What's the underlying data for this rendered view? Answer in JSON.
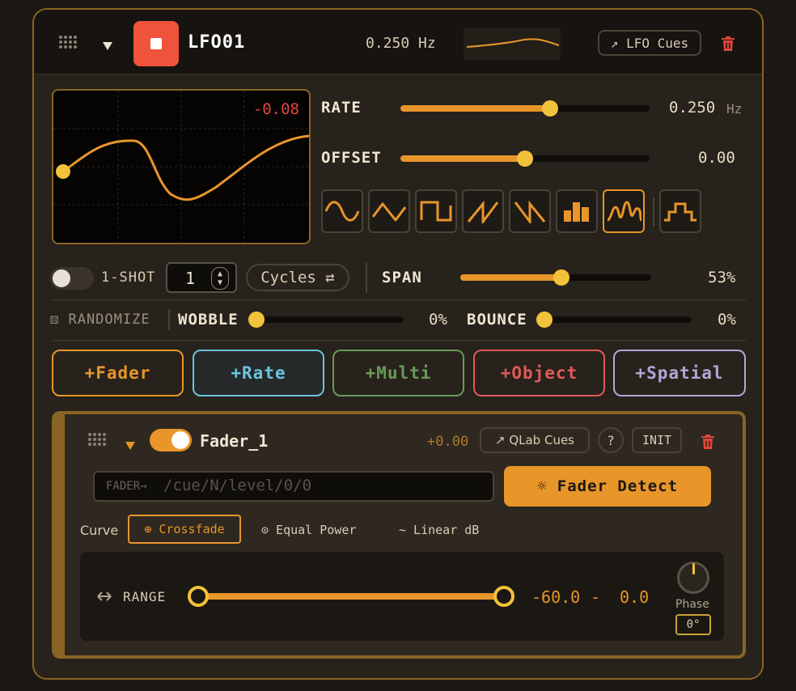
{
  "header": {
    "title": "LFO01",
    "freq_display": "0.250 Hz",
    "cues_button": "↗ LFO Cues"
  },
  "scope": {
    "readout": "-0.08"
  },
  "rate": {
    "label": "RATE",
    "value": "0.250",
    "unit": "Hz",
    "level": 0.6
  },
  "offset": {
    "label": "OFFSET",
    "value": "0.00",
    "level": 0.5
  },
  "waveforms": [
    "sine-icon",
    "triangle-icon",
    "square-icon",
    "saw-up-icon",
    "saw-down-icon",
    "random-bars-icon",
    "smooth-random-icon",
    "step-icon"
  ],
  "waveform_selected": 6,
  "oneshot": {
    "label": "1-SHOT",
    "count": "1",
    "cycles_label": "Cycles ⇄",
    "enabled": false
  },
  "span": {
    "label": "SPAN",
    "value": "53%",
    "level": 0.53
  },
  "randomize": {
    "label": "⚄ RANDOMIZE",
    "wobble_label": "WOBBLE",
    "wobble_value": "0%",
    "wobble_level": 0,
    "bounce_label": "BOUNCE",
    "bounce_value": "0%",
    "bounce_level": 0
  },
  "add_buttons": [
    {
      "label": "+Fader",
      "color": "#e8952a"
    },
    {
      "label": "+Rate",
      "color": "#6cc3e0"
    },
    {
      "label": "+Multi",
      "color": "#6a9a5a"
    },
    {
      "label": "+Object",
      "color": "#e05a5a"
    },
    {
      "label": "+Spatial",
      "color": "#b4a6d8"
    }
  ],
  "fader": {
    "name": "Fader_1",
    "value": "+0.00",
    "cues_button": "↗ QLab Cues",
    "help": "?",
    "init": "INIT",
    "path_prefix": "FADER→",
    "path_placeholder": "/cue/N/level/0/0",
    "detect_button": "☼ Fader Detect",
    "curve_label": "Curve",
    "curve_options": [
      "⊕ Crossfade",
      "⊙ Equal Power",
      "~ Linear dB"
    ],
    "curve_selected": 0,
    "range_label": "RANGE",
    "range_min": "-60.0",
    "range_sep": "-",
    "range_max": "0.0",
    "phase_label": "Phase",
    "phase_value": "0°"
  },
  "colors": {
    "accent": "#e8952a",
    "knob": "#f2c23a",
    "danger": "#e0453a",
    "readout": "#e0453a"
  }
}
